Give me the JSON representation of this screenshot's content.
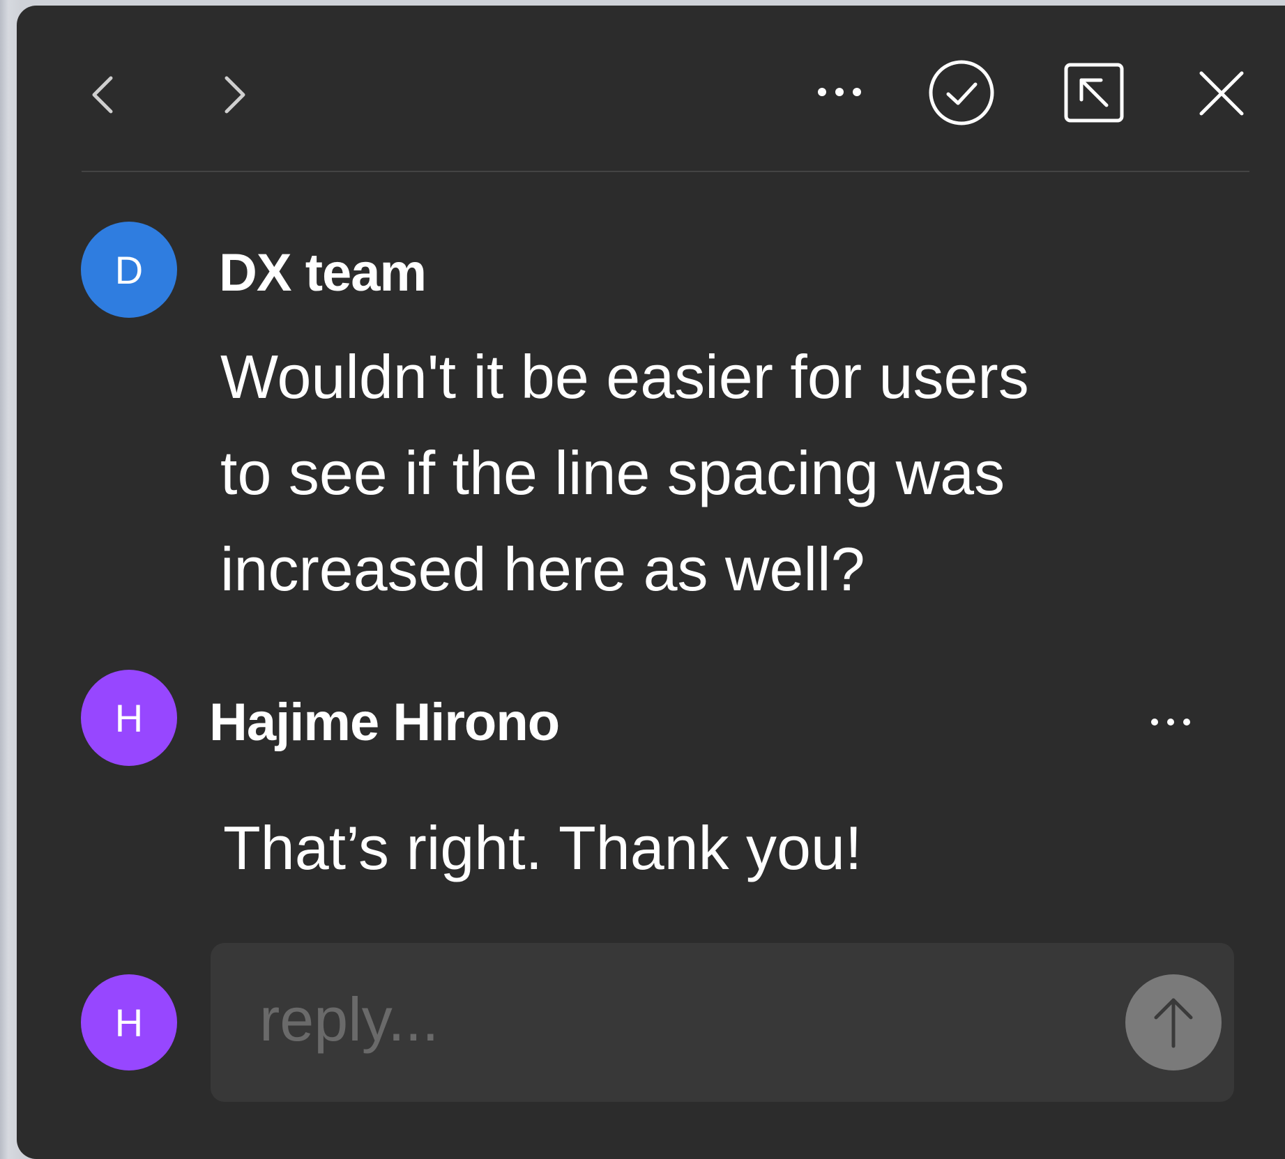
{
  "toolbar": {
    "icons": [
      "chevron-left-icon",
      "chevron-right-icon",
      "more-icon",
      "resolve-check-icon",
      "collapse-icon",
      "close-icon"
    ]
  },
  "thread": {
    "comments": [
      {
        "avatar_initial": "D",
        "avatar_color": "#2f7de0",
        "author": "DX team",
        "text": "Wouldn't it be easier for users\nto see if the line spacing was\nincreased here as well?"
      },
      {
        "avatar_initial": "H",
        "avatar_color": "#9747ff",
        "author": "Hajime Hirono",
        "text": "That’s right. Thank you!"
      }
    ]
  },
  "reply": {
    "avatar_initial": "H",
    "avatar_color": "#9747ff",
    "placeholder": "reply...",
    "value": ""
  },
  "colors": {
    "panel_bg": "#2c2c2c",
    "input_bg": "#383838",
    "send_button": "#7a7a7a"
  }
}
